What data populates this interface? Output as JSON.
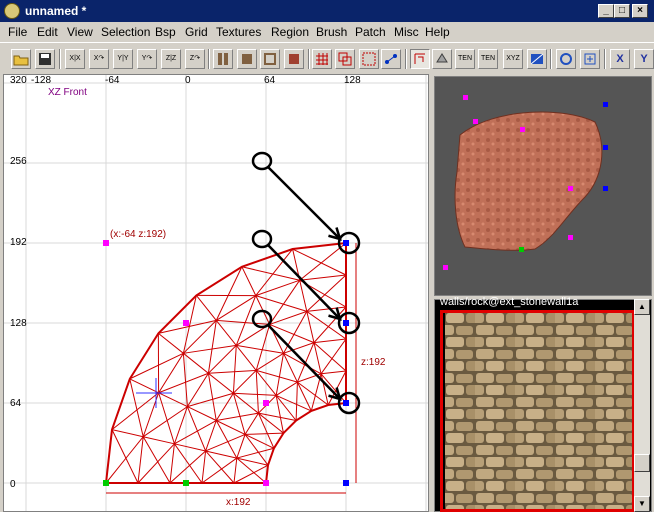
{
  "window": {
    "title": "unnamed *",
    "minimize": "_",
    "maximize": "□",
    "close": "×"
  },
  "menubar": [
    "File",
    "Edit",
    "View",
    "Selection",
    "Bsp",
    "Grid",
    "Textures",
    "Region",
    "Brush",
    "Patch",
    "Misc",
    "Help"
  ],
  "toolbar": {
    "buttons": [
      {
        "name": "open-icon",
        "label": ""
      },
      {
        "name": "save-icon",
        "label": ""
      },
      {
        "name": "flip-x-icon",
        "label": "X|X"
      },
      {
        "name": "rotate-x-icon",
        "label": "X↷"
      },
      {
        "name": "flip-y-icon",
        "label": "Y|Y"
      },
      {
        "name": "rotate-y-icon",
        "label": "Y↷"
      },
      {
        "name": "flip-z-icon",
        "label": "Z|Z"
      },
      {
        "name": "rotate-z-icon",
        "label": "Z↷"
      },
      {
        "name": "csg-subtract-icon",
        "label": ""
      },
      {
        "name": "csg-merge-icon",
        "label": ""
      },
      {
        "name": "make-hollow-icon",
        "label": ""
      },
      {
        "name": "clipper-icon",
        "label": ""
      },
      {
        "name": "grid-show-icon",
        "label": ""
      },
      {
        "name": "cubic-clip-icon",
        "label": ""
      },
      {
        "name": "filter-icon",
        "label": ""
      },
      {
        "name": "path-icon",
        "label": ""
      },
      {
        "name": "select-icon",
        "label": ""
      },
      {
        "name": "texture-lock-icon",
        "label": ""
      },
      {
        "name": "ten-fit-icon",
        "label": "TEN FIT"
      },
      {
        "name": "ten-flip-icon",
        "label": "TEN FLIP"
      },
      {
        "name": "xyz-icon",
        "label": "XYZ"
      },
      {
        "name": "view-icon",
        "label": ""
      },
      {
        "name": "rotate-view-icon",
        "label": ""
      },
      {
        "name": "center-view-icon",
        "label": ""
      },
      {
        "name": "x-button",
        "label": "X"
      },
      {
        "name": "y-button",
        "label": "Y"
      }
    ]
  },
  "viewport": {
    "view_label": "XZ Front",
    "top_ruler": [
      "-128",
      "-64",
      "0",
      "64",
      "128"
    ],
    "left_ruler": [
      "320",
      "256",
      "192",
      "128",
      "64",
      "0"
    ],
    "corner_label": "(x:-64  z:192)",
    "dim_z": "z:192",
    "dim_x": "x:192"
  },
  "texture": {
    "name": "walls/rock@ext_stonewall1a"
  },
  "colors": {
    "accent": "#0a246a",
    "patch": "#cc0000",
    "annotation": "#000000",
    "handle_magenta": "#ff00ff",
    "handle_green": "#00cc00",
    "handle_blue": "#0000ff"
  }
}
